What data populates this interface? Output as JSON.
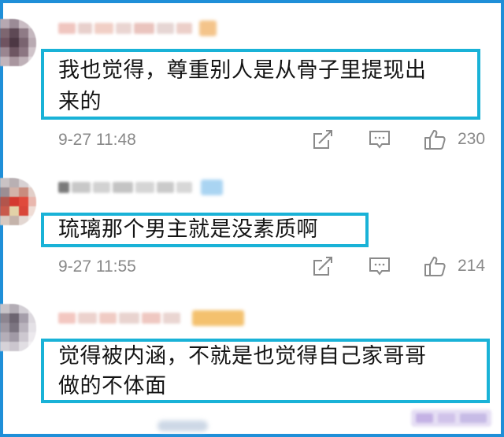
{
  "comments": [
    {
      "text_line1": "我也觉得，尊重别人是从骨子里提现出",
      "text_line2": "来的",
      "time": "9-27 11:48",
      "likes": "230",
      "badge_color": "#f4c48a"
    },
    {
      "text_line1": "琉璃那个男主就是没素质啊",
      "time": "9-27 11:55",
      "likes": "214",
      "badge_color": "#a9d4f2"
    },
    {
      "text_line1": "觉得被内涵，不就是也觉得自己家哥哥",
      "text_line2": "做的不体面",
      "badge_color": "#f4c16e"
    }
  ],
  "icons": {
    "share": "share-icon",
    "reply": "comment-icon",
    "like": "thumbs-up-icon"
  },
  "colors": {
    "frame": "#1f8fd8",
    "highlight": "#19b2d7",
    "meta_text": "#888888"
  }
}
